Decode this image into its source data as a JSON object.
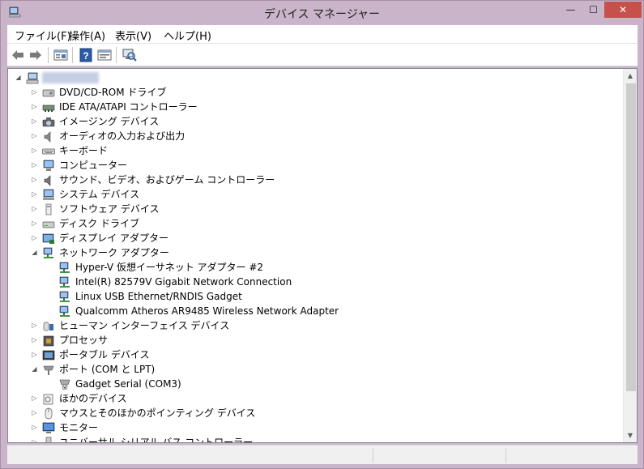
{
  "window": {
    "title": "デバイス マネージャー",
    "controls": {
      "minimize": "—",
      "maximize": "☐",
      "close": "✕"
    }
  },
  "menu": {
    "file": "ファイル(F)",
    "action": "操作(A)",
    "view": "表示(V)",
    "help": "ヘルプ(H)"
  },
  "toolbar": {
    "icons": [
      "back-arrow-icon",
      "forward-arrow-icon",
      "properties-icon",
      "help-icon",
      "update-view-icon",
      "scan-hardware-icon"
    ]
  },
  "tree": {
    "root": {
      "label": "Hidden computer name",
      "expanded": true
    },
    "items": [
      {
        "label": "DVD/CD-ROM ドライブ",
        "icon": "dvd-drive-icon",
        "expanded": false
      },
      {
        "label": "IDE ATA/ATAPI コントローラー",
        "icon": "ide-controller-icon",
        "expanded": false
      },
      {
        "label": "イメージング デバイス",
        "icon": "camera-icon",
        "expanded": false
      },
      {
        "label": "オーディオの入力および出力",
        "icon": "speaker-icon",
        "expanded": false
      },
      {
        "label": "キーボード",
        "icon": "keyboard-icon",
        "expanded": false
      },
      {
        "label": "コンピューター",
        "icon": "computer-icon",
        "expanded": false
      },
      {
        "label": "サウンド、ビデオ、およびゲーム コントローラー",
        "icon": "sound-icon",
        "expanded": false
      },
      {
        "label": "システム デバイス",
        "icon": "system-device-icon",
        "expanded": false
      },
      {
        "label": "ソフトウェア デバイス",
        "icon": "software-device-icon",
        "expanded": false
      },
      {
        "label": "ディスク ドライブ",
        "icon": "disk-drive-icon",
        "expanded": false
      },
      {
        "label": "ディスプレイ アダプター",
        "icon": "display-adapter-icon",
        "expanded": false
      },
      {
        "label": "ネットワーク アダプター",
        "icon": "network-adapter-icon",
        "expanded": true,
        "children": [
          "Hyper-V 仮想イーサネット アダプター #2",
          "Intel(R) 82579V Gigabit Network Connection",
          "Linux USB Ethernet/RNDIS Gadget",
          "Qualcomm Atheros AR9485 Wireless Network Adapter"
        ]
      },
      {
        "label": "ヒューマン インターフェイス デバイス",
        "icon": "hid-icon",
        "expanded": false
      },
      {
        "label": "プロセッサ",
        "icon": "processor-icon",
        "expanded": false
      },
      {
        "label": "ポータブル デバイス",
        "icon": "portable-device-icon",
        "expanded": false
      },
      {
        "label": "ポート (COM と LPT)",
        "icon": "port-icon",
        "expanded": true,
        "children": [
          "Gadget Serial (COM3)"
        ]
      },
      {
        "label": "ほかのデバイス",
        "icon": "other-device-icon",
        "expanded": false
      },
      {
        "label": "マウスとそのほかのポインティング デバイス",
        "icon": "mouse-icon",
        "expanded": false
      },
      {
        "label": "モニター",
        "icon": "monitor-icon",
        "expanded": false
      },
      {
        "label": "ユニバーサル シリアル バス コントローラー",
        "icon": "usb-controller-icon",
        "expanded": false
      }
    ]
  },
  "colors": {
    "titlebar": "#c9b4ca",
    "close_button": "#c7504b"
  }
}
